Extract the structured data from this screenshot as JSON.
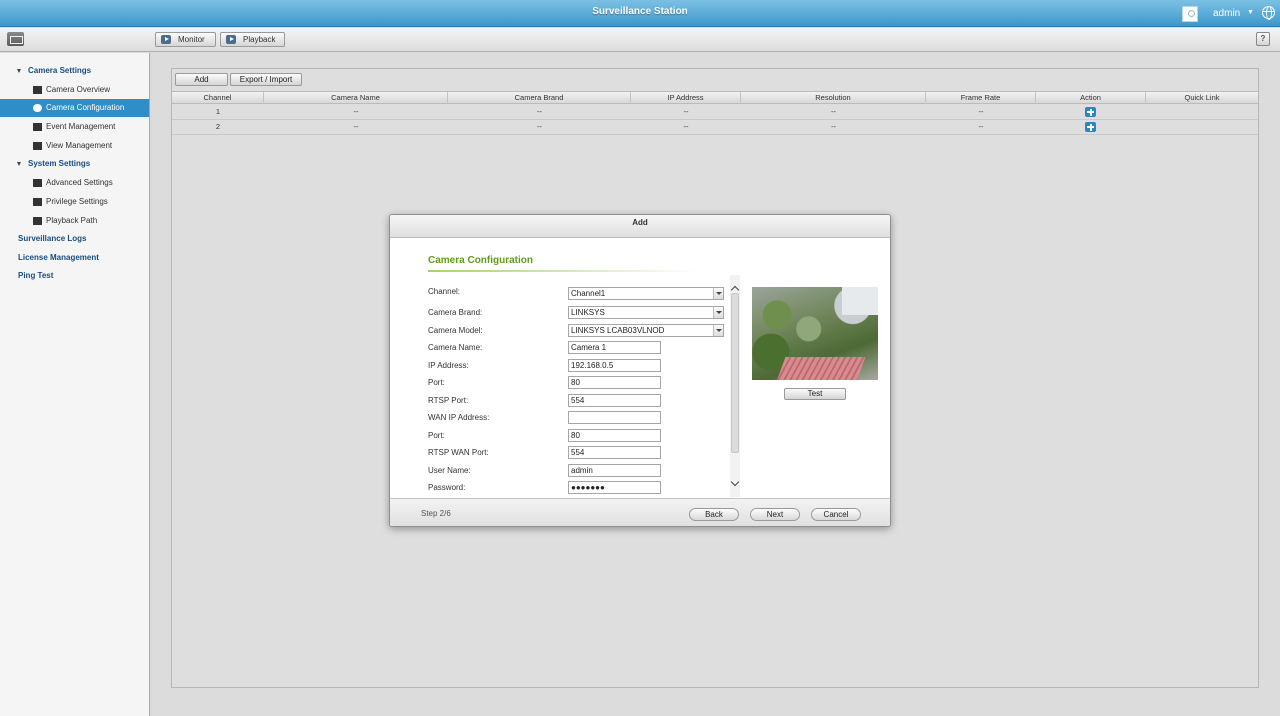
{
  "app": {
    "title": "Surveillance Station",
    "username": "admin"
  },
  "toolbar": {
    "monitor_label": "Monitor",
    "playback_label": "Playback",
    "help_label": "?"
  },
  "sidebar": {
    "camera_settings": "Camera Settings",
    "camera_overview": "Camera Overview",
    "camera_configuration": "Camera Configuration",
    "event_management": "Event Management",
    "view_management": "View Management",
    "system_settings": "System Settings",
    "advanced_settings": "Advanced Settings",
    "privilege_settings": "Privilege Settings",
    "playback_path": "Playback Path",
    "surveillance_logs": "Surveillance Logs",
    "license_management": "License Management",
    "ping_test": "Ping Test"
  },
  "panel": {
    "add_label": "Add",
    "export_label": "Export / Import",
    "columns": [
      "Channel",
      "Camera Name",
      "Camera Brand",
      "IP Address",
      "Resolution",
      "Frame Rate",
      "Action",
      "Quick Link"
    ],
    "rows": [
      {
        "channel": "1",
        "name": "--",
        "brand": "--",
        "ip": "--",
        "resolution": "--",
        "framerate": "--"
      },
      {
        "channel": "2",
        "name": "--",
        "brand": "--",
        "ip": "--",
        "resolution": "--",
        "framerate": "--"
      }
    ]
  },
  "modal": {
    "title": "Add",
    "section_title": "Camera Configuration",
    "fields": {
      "channel": {
        "label": "Channel:",
        "value": "Channel1"
      },
      "brand": {
        "label": "Camera Brand:",
        "value": "LINKSYS"
      },
      "model": {
        "label": "Camera Model:",
        "value": "LINKSYS LCAB03VLNOD"
      },
      "name": {
        "label": "Camera Name:",
        "value": "Camera 1"
      },
      "ip": {
        "label": "IP Address:",
        "value": "192.168.0.5"
      },
      "port": {
        "label": "Port:",
        "value": "80"
      },
      "rtsp_port": {
        "label": "RTSP Port:",
        "value": "554"
      },
      "wan_ip": {
        "label": "WAN IP Address:",
        "value": ""
      },
      "wan_port": {
        "label": "Port:",
        "value": "80"
      },
      "rtsp_wan_port": {
        "label": "RTSP WAN Port:",
        "value": "554"
      },
      "user": {
        "label": "User Name:",
        "value": "admin"
      },
      "password": {
        "label": "Password:",
        "value": "●●●●●●●"
      }
    },
    "test_label": "Test",
    "step": "Step 2/6",
    "back_label": "Back",
    "next_label": "Next",
    "cancel_label": "Cancel"
  }
}
